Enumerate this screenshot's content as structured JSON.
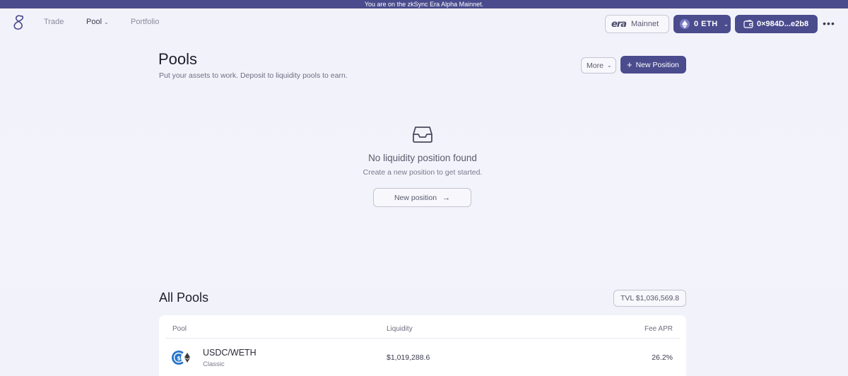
{
  "banner": {
    "text": "You are on the zkSync Era Alpha Mainnet."
  },
  "nav": {
    "trade": "Trade",
    "pool": "Pool",
    "portfolio": "Portfolio"
  },
  "network": {
    "logo_text": "era",
    "name": "Mainnet"
  },
  "balance": {
    "label": "0  ETH"
  },
  "wallet": {
    "address": "0×984D...e2b8"
  },
  "header": {
    "title": "Pools",
    "subtitle": "Put your assets to work. Deposit to liquidity pools to earn.",
    "more_label": "More",
    "new_position_label": "New Position"
  },
  "empty_state": {
    "title": "No liquidity position found",
    "subtitle": "Create a new position to get started.",
    "button_label": "New position"
  },
  "all_pools": {
    "title": "All Pools",
    "tvl": "TVL $1,036,569.8",
    "columns": {
      "pool": "Pool",
      "liquidity": "Liquidity",
      "fee_apr": "Fee APR"
    },
    "rows": [
      {
        "pair": "USDC/WETH",
        "type": "Classic",
        "liquidity": "$1,019,288.6",
        "fee_apr": "26.2%"
      }
    ]
  },
  "colors": {
    "accent": "#4b4c8e",
    "banner": "#4a4b8c",
    "background": "#f2f2fb",
    "usdc": "#2775ca",
    "eth": "#3c3c3d"
  },
  "icons": {
    "logo": "syncswap-logo-icon",
    "eth": "ethereum-icon",
    "wallet": "wallet-icon",
    "more": "more-horizontal-icon",
    "empty": "inbox-icon",
    "arrow": "arrow-right-icon",
    "plus": "plus-icon"
  }
}
